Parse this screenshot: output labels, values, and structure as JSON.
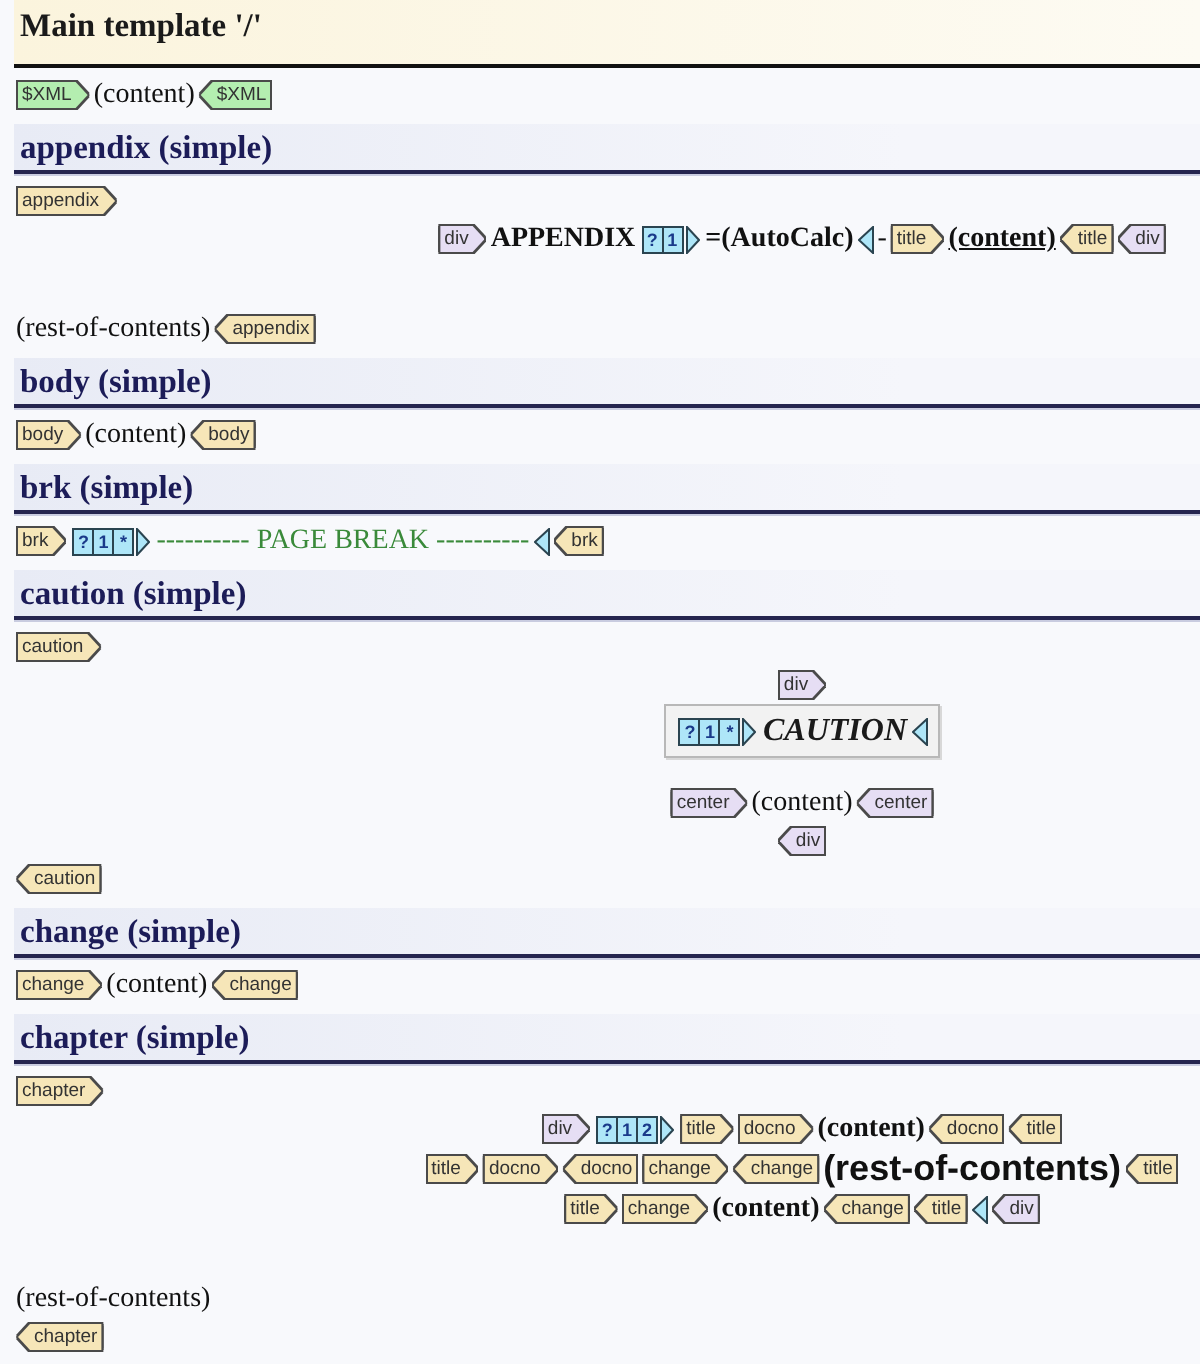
{
  "sections": [
    {
      "kind": "main",
      "title": "Main template '/'",
      "lines": [
        {
          "kind": "line",
          "items": [
            {
              "kind": "open",
              "tag": "$XML",
              "color": "#b4eeb0"
            },
            {
              "kind": "text",
              "text": "(content)"
            },
            {
              "kind": "close",
              "tag": "$XML",
              "color": "#b4eeb0"
            }
          ]
        }
      ]
    },
    {
      "kind": "template",
      "title": "appendix (simple)",
      "lines": [
        {
          "kind": "line",
          "items": [
            {
              "kind": "open",
              "tag": "appendix",
              "color": "#f6e6b8"
            }
          ]
        },
        {
          "kind": "centered",
          "items": [
            {
              "kind": "open",
              "tag": "div",
              "color": "#e6def4"
            },
            {
              "kind": "strong",
              "text": "APPENDIX"
            },
            {
              "kind": "number",
              "cells": [
                "?",
                "1"
              ]
            },
            {
              "kind": "strong",
              "text": "=(AutoCalc)"
            },
            {
              "kind": "number-end"
            },
            {
              "kind": "text",
              "text": "-"
            },
            {
              "kind": "open",
              "tag": "title",
              "color": "#f6e6b8"
            },
            {
              "kind": "link",
              "text": "(content)"
            },
            {
              "kind": "close",
              "tag": "title",
              "color": "#f6e6b8"
            },
            {
              "kind": "close",
              "tag": "div",
              "color": "#e6def4"
            }
          ]
        },
        {
          "kind": "blank"
        },
        {
          "kind": "blank"
        },
        {
          "kind": "line",
          "items": [
            {
              "kind": "text",
              "text": "(rest-of-contents)"
            },
            {
              "kind": "close",
              "tag": "appendix",
              "color": "#f6e6b8"
            }
          ]
        }
      ]
    },
    {
      "kind": "template",
      "title": "body (simple)",
      "lines": [
        {
          "kind": "line",
          "items": [
            {
              "kind": "open",
              "tag": "body",
              "color": "#f6e6b8"
            },
            {
              "kind": "text",
              "text": "(content)"
            },
            {
              "kind": "close",
              "tag": "body",
              "color": "#f6e6b8"
            }
          ]
        }
      ]
    },
    {
      "kind": "template",
      "title": "brk (simple)",
      "lines": [
        {
          "kind": "line",
          "items": [
            {
              "kind": "open",
              "tag": "brk",
              "color": "#f6e6b8"
            },
            {
              "kind": "number",
              "cells": [
                "?",
                "1",
                "*"
              ]
            },
            {
              "kind": "break",
              "text": "---------- PAGE BREAK ----------"
            },
            {
              "kind": "number-end"
            },
            {
              "kind": "close",
              "tag": "brk",
              "color": "#f6e6b8"
            }
          ]
        }
      ]
    },
    {
      "kind": "template",
      "title": "caution (simple)",
      "lines": [
        {
          "kind": "line",
          "items": [
            {
              "kind": "open",
              "tag": "caution",
              "color": "#f6e6b8"
            }
          ]
        },
        {
          "kind": "centered",
          "items": [
            {
              "kind": "open",
              "tag": "div",
              "color": "#e6def4"
            }
          ]
        },
        {
          "kind": "boxed",
          "items": [
            {
              "kind": "number",
              "cells": [
                "?",
                "1",
                "*"
              ]
            },
            {
              "kind": "heading",
              "text": "CAUTION"
            },
            {
              "kind": "number-end"
            }
          ]
        },
        {
          "kind": "blank"
        },
        {
          "kind": "centered",
          "items": [
            {
              "kind": "open",
              "tag": "center",
              "color": "#e6def4"
            },
            {
              "kind": "text",
              "text": "(content)"
            },
            {
              "kind": "close",
              "tag": "center",
              "color": "#e6def4"
            }
          ]
        },
        {
          "kind": "centered",
          "items": [
            {
              "kind": "close",
              "tag": "div",
              "color": "#e6def4"
            }
          ]
        },
        {
          "kind": "line",
          "items": [
            {
              "kind": "close",
              "tag": "caution",
              "color": "#f6e6b8"
            }
          ]
        }
      ]
    },
    {
      "kind": "template",
      "title": "change (simple)",
      "lines": [
        {
          "kind": "line",
          "items": [
            {
              "kind": "open",
              "tag": "change",
              "color": "#f6e6b8"
            },
            {
              "kind": "text",
              "text": "(content)"
            },
            {
              "kind": "close",
              "tag": "change",
              "color": "#f6e6b8"
            }
          ]
        }
      ]
    },
    {
      "kind": "template",
      "title": "chapter (simple)",
      "lines": [
        {
          "kind": "line",
          "items": [
            {
              "kind": "open",
              "tag": "chapter",
              "color": "#f6e6b8"
            }
          ]
        },
        {
          "kind": "centered",
          "items": [
            {
              "kind": "open",
              "tag": "div",
              "color": "#e6def4"
            },
            {
              "kind": "number",
              "cells": [
                "?",
                "1",
                "2"
              ]
            },
            {
              "kind": "open",
              "tag": "title",
              "color": "#f6e6b8"
            },
            {
              "kind": "open",
              "tag": "docno",
              "color": "#f6e6b8"
            },
            {
              "kind": "strong",
              "text": "(content)"
            },
            {
              "kind": "close",
              "tag": "docno",
              "color": "#f6e6b8"
            },
            {
              "kind": "close",
              "tag": "title",
              "color": "#f6e6b8"
            }
          ]
        },
        {
          "kind": "centered",
          "items": [
            {
              "kind": "open",
              "tag": "title",
              "color": "#f6e6b8"
            },
            {
              "kind": "open",
              "tag": "docno",
              "color": "#f6e6b8"
            },
            {
              "kind": "close",
              "tag": "docno",
              "color": "#f6e6b8"
            },
            {
              "kind": "open",
              "tag": "change",
              "color": "#f6e6b8"
            },
            {
              "kind": "close",
              "tag": "change",
              "color": "#f6e6b8"
            },
            {
              "kind": "large",
              "text": "(rest-of-contents)"
            },
            {
              "kind": "close",
              "tag": "title",
              "color": "#f6e6b8"
            }
          ]
        },
        {
          "kind": "centered",
          "items": [
            {
              "kind": "open",
              "tag": "title",
              "color": "#f6e6b8"
            },
            {
              "kind": "open",
              "tag": "change",
              "color": "#f6e6b8"
            },
            {
              "kind": "strong",
              "text": "(content)"
            },
            {
              "kind": "close",
              "tag": "change",
              "color": "#f6e6b8"
            },
            {
              "kind": "close",
              "tag": "title",
              "color": "#f6e6b8"
            },
            {
              "kind": "number-end"
            },
            {
              "kind": "close",
              "tag": "div",
              "color": "#e6def4"
            }
          ]
        },
        {
          "kind": "blank"
        },
        {
          "kind": "blank"
        },
        {
          "kind": "line",
          "items": [
            {
              "kind": "text",
              "text": "(rest-of-contents)"
            }
          ]
        },
        {
          "kind": "line",
          "items": [
            {
              "kind": "close",
              "tag": "chapter",
              "color": "#f6e6b8"
            }
          ]
        }
      ]
    }
  ]
}
